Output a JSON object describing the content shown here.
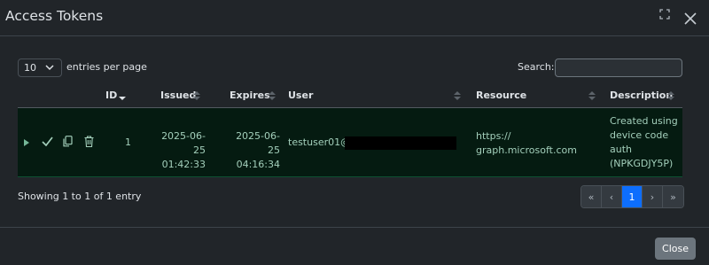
{
  "modal": {
    "title": "Access Tokens"
  },
  "controls": {
    "length_value": "10",
    "length_label": "entries per page",
    "search_label": "Search:",
    "search_value": ""
  },
  "table": {
    "columns": [
      "ID",
      "Issued",
      "Expires",
      "User",
      "Resource",
      "Description"
    ],
    "rows": [
      {
        "id": "1",
        "issued": [
          "2025-06-25",
          "01:42:33"
        ],
        "expires": [
          "2025-06-25",
          "04:16:34"
        ],
        "user": "testuser01@",
        "resource": [
          "https://",
          "graph.microsoft.com"
        ],
        "description": [
          "Created using",
          "device code",
          "auth",
          "(NPKGDJY5P)"
        ]
      }
    ]
  },
  "info": "Showing 1 to 1 of 1 entry",
  "pagination": [
    "«",
    "‹",
    "1",
    "›",
    "»"
  ],
  "footer": {
    "close_label": "Close"
  },
  "colors": {
    "accent": "#0d6efd",
    "row_bg": "#051b11",
    "row_text": "#a3cfbb"
  }
}
